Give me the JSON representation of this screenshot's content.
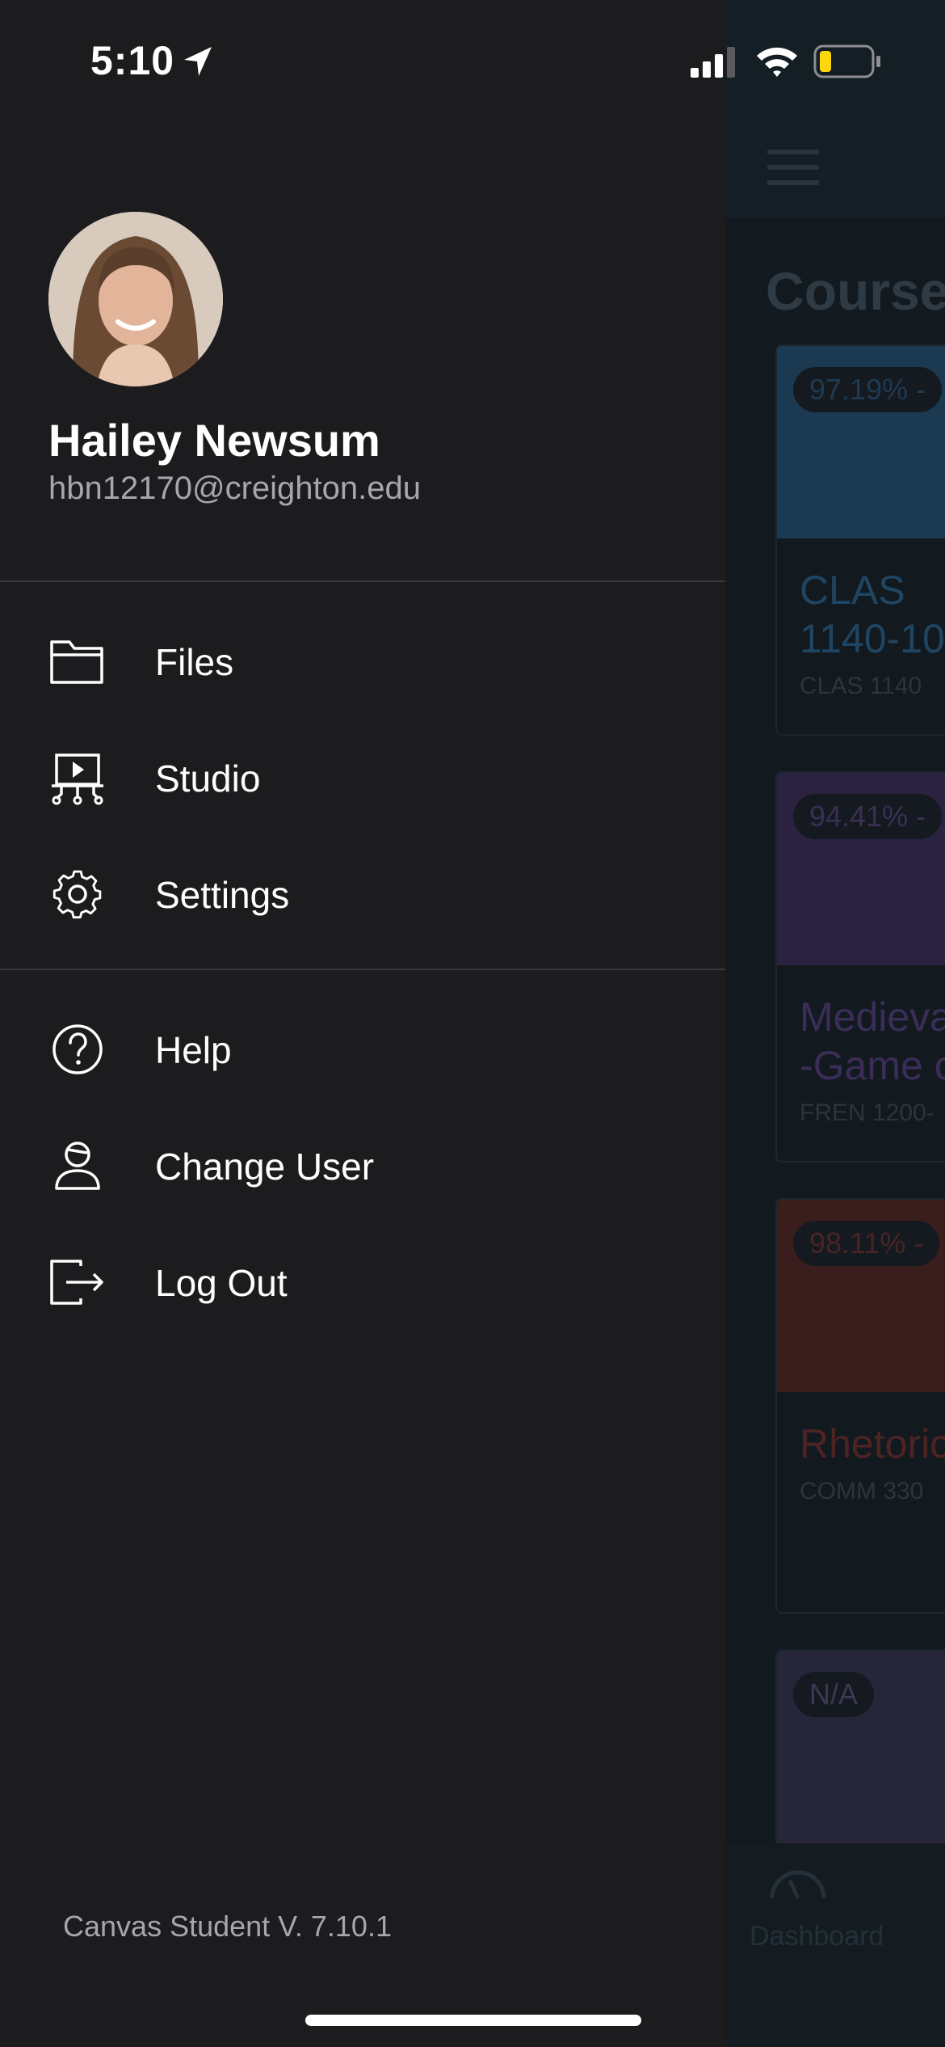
{
  "status_bar": {
    "time": "5:10",
    "icons": [
      "location-arrow-icon",
      "cellular-signal-icon",
      "wifi-icon",
      "battery-low-icon"
    ]
  },
  "drawer": {
    "user": {
      "name": "Hailey Newsum",
      "email": "hbn12170@creighton.edu"
    },
    "menu_primary": [
      {
        "label": "Files",
        "icon": "folder-icon"
      },
      {
        "label": "Studio",
        "icon": "studio-icon"
      },
      {
        "label": "Settings",
        "icon": "gear-icon"
      }
    ],
    "menu_secondary": [
      {
        "label": "Help",
        "icon": "help-icon"
      },
      {
        "label": "Change User",
        "icon": "change-user-icon"
      },
      {
        "label": "Log Out",
        "icon": "logout-icon"
      }
    ],
    "app_version": "Canvas Student V. 7.10.1"
  },
  "background": {
    "title": "Course",
    "courses": [
      {
        "grade": "97.19% -",
        "name_lines": [
          "CLAS",
          "1140-10"
        ],
        "code": "CLAS 1140",
        "color": "#1b4a6e"
      },
      {
        "grade": "94.41% -",
        "name_lines": [
          "Medieva",
          "-Game o"
        ],
        "code": "FREN 1200-",
        "color": "#3b2a5a"
      },
      {
        "grade": "98.11% -",
        "name_lines": [
          "Rhetoric"
        ],
        "code": "COMM 330",
        "color": "#5a2424"
      },
      {
        "grade": "N/A",
        "name_lines": [],
        "code": "",
        "color": "#2e2d45"
      }
    ],
    "tab_bar": {
      "dashboard_label": "Dashboard"
    }
  },
  "colors": {
    "drawer_bg": "#1c1c1e",
    "divider": "#38383c",
    "secondary_text": "#a6a6ab"
  }
}
